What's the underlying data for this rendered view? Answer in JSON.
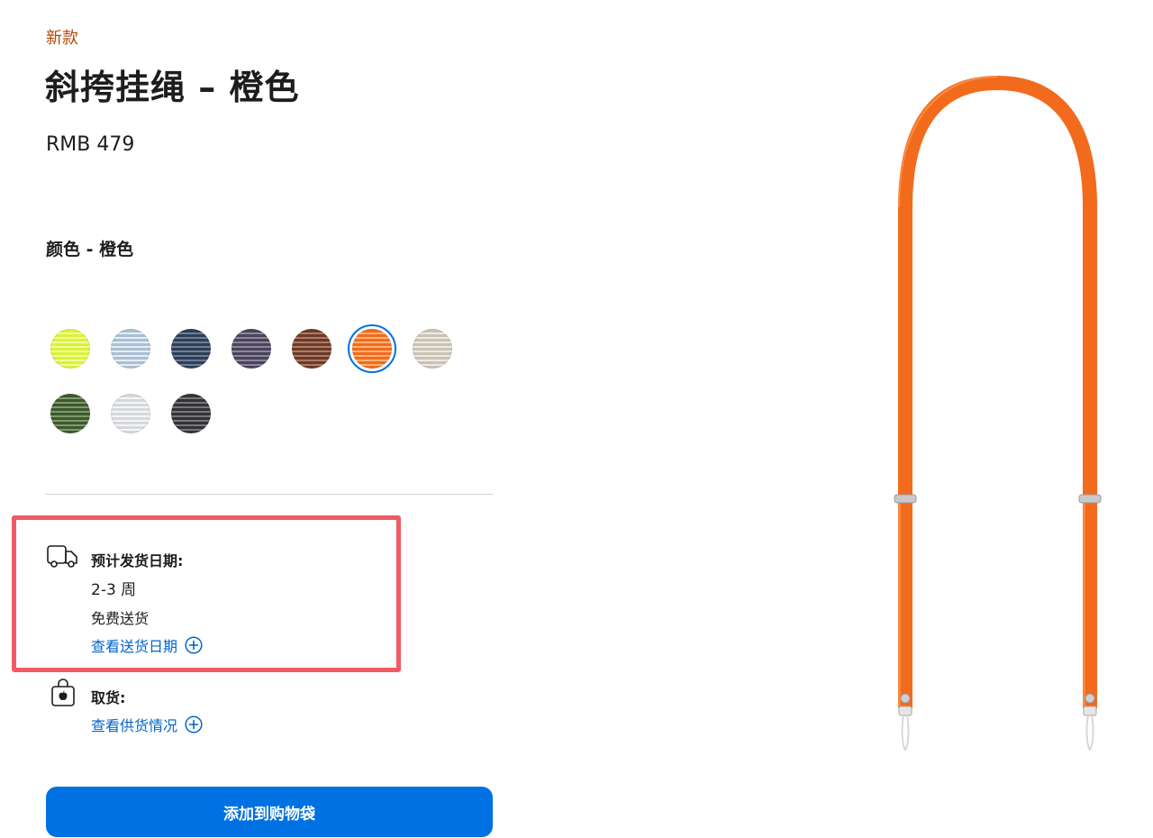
{
  "product": {
    "badge": "新款",
    "title": "斜挎挂绳 – 橙色",
    "price": "RMB 479",
    "color_label": "颜色 - 橙色",
    "selected_color_index": 5
  },
  "colors": [
    {
      "name": "荧光黄",
      "base": "#d9f23a",
      "stripe": "#f3ff9a"
    },
    {
      "name": "浅蓝",
      "base": "#a9bfd3",
      "stripe": "#e6eef5"
    },
    {
      "name": "深蓝",
      "base": "#2e3f55",
      "stripe": "#6d7f97"
    },
    {
      "name": "紫灰",
      "base": "#4a4459",
      "stripe": "#8d86a0"
    },
    {
      "name": "棕色",
      "base": "#6b3a2a",
      "stripe": "#b07a65"
    },
    {
      "name": "橙色",
      "base": "#f26b1d",
      "stripe": "#ffb37a"
    },
    {
      "name": "灰米色",
      "base": "#c9c3b6",
      "stripe": "#eeebe4"
    },
    {
      "name": "绿色",
      "base": "#3d5a2e",
      "stripe": "#7f9a6c"
    },
    {
      "name": "浅灰",
      "base": "#d6d8dc",
      "stripe": "#f4f5f7"
    },
    {
      "name": "深灰",
      "base": "#333336",
      "stripe": "#77777c"
    }
  ],
  "delivery": {
    "label": "预计发货日期:",
    "time": "2-3 周",
    "shipping": "免费送货",
    "link": "查看送货日期"
  },
  "pickup": {
    "label": "取货:",
    "link": "查看供货情况"
  },
  "add_to_bag": "添加到购物袋",
  "accent_color": "#0071e3",
  "highlight_color": "#f05a64",
  "strap_color": "#f26b1d"
}
